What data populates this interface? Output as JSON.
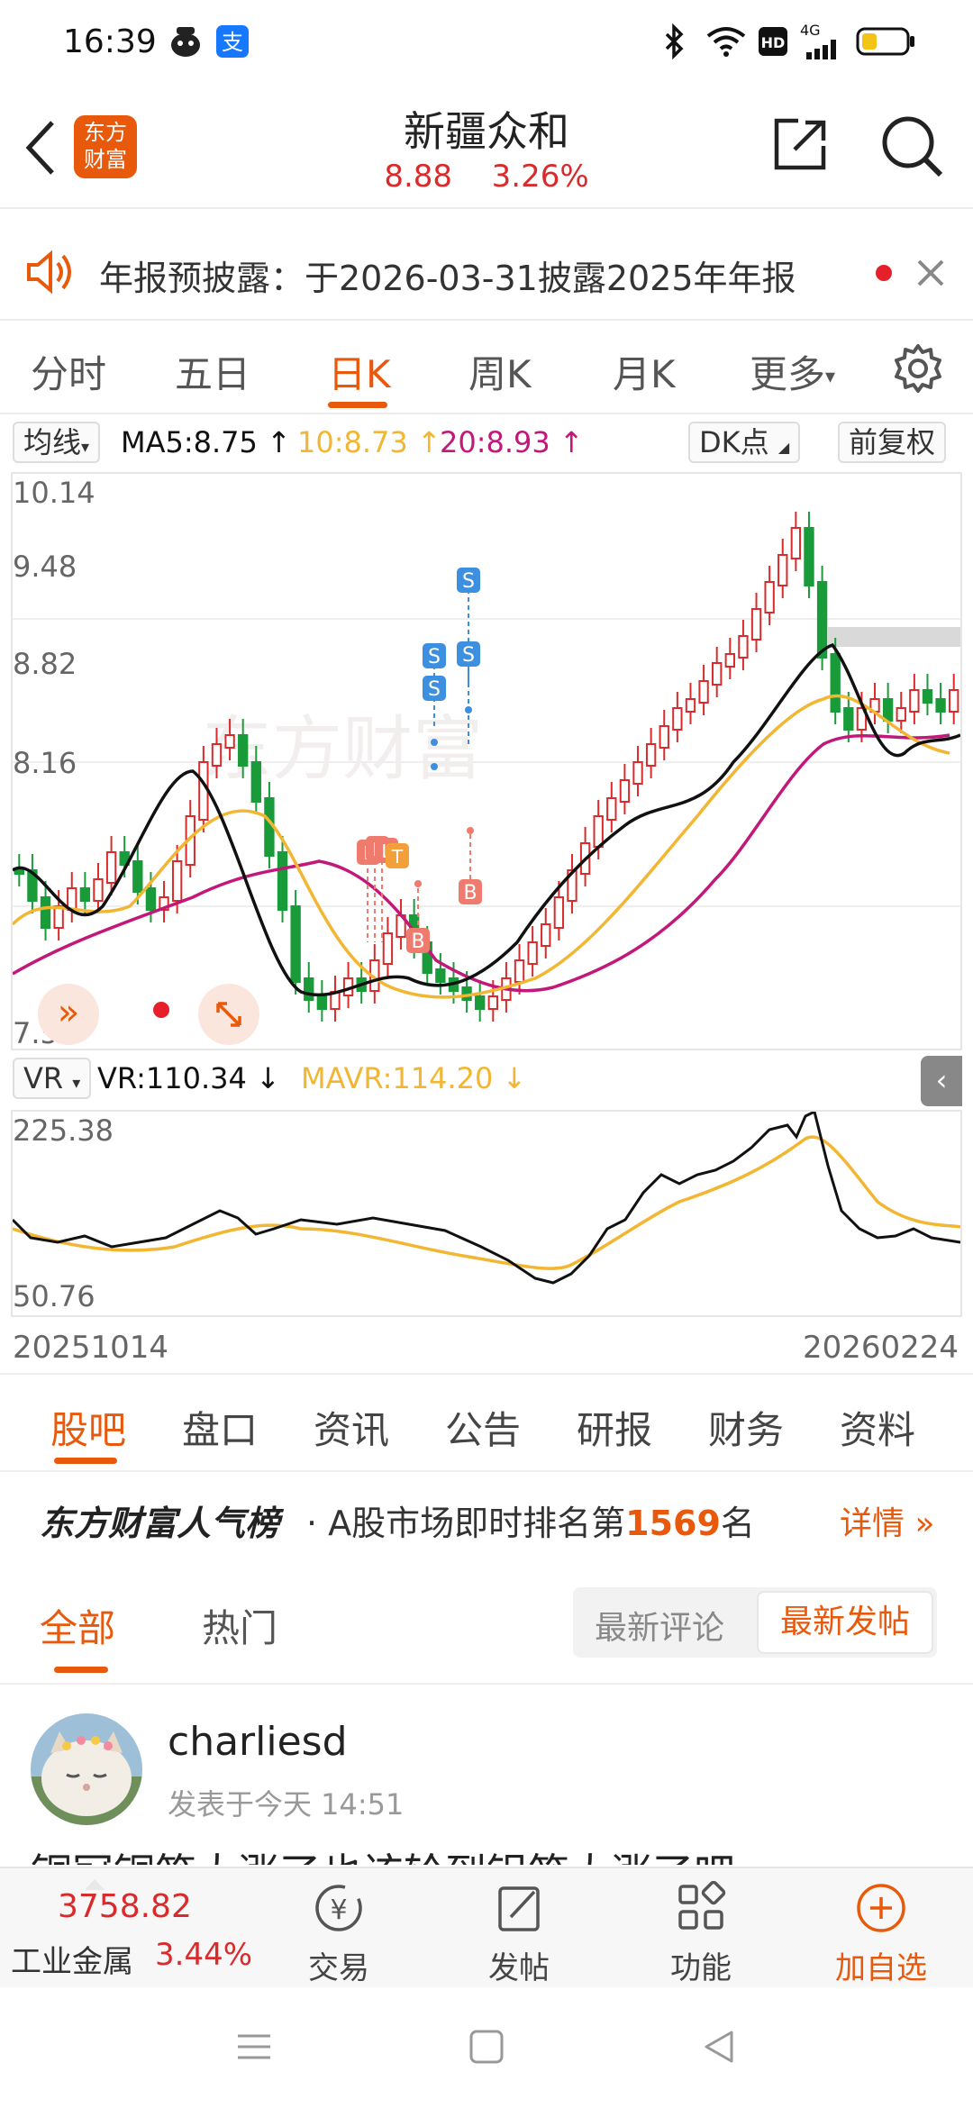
{
  "status_bar": {
    "time": "16:39",
    "network": "4G"
  },
  "header": {
    "stock_name": "新疆众和",
    "price": "8.88",
    "change_pct": "3.26%",
    "logo_text_top": "东方",
    "logo_text_bottom": "财富"
  },
  "notice": {
    "text": "年报预披露：于2026-03-31披露2025年年报"
  },
  "k_tabs": [
    "分时",
    "五日",
    "日K",
    "周K",
    "月K",
    "更多"
  ],
  "k_active_index": 2,
  "indicators": {
    "line_type": "均线",
    "ma5": "MA5:8.75",
    "ma10": "10:8.73",
    "ma20": "20:8.93",
    "dk_label": "DK点",
    "adjust_label": "前复权"
  },
  "main_chart": {
    "y_labels": [
      "10.14",
      "9.48",
      "8.82",
      "8.16",
      "7.50"
    ],
    "watermark": "东方财富"
  },
  "vr": {
    "select_label": "VR",
    "vr_value": "VR:110.34",
    "mavr_value": "MAVR:114.20",
    "y_labels": [
      "225.38",
      "50.76"
    ]
  },
  "dates": {
    "start": "20251014",
    "end": "20260224"
  },
  "sub_tabs": [
    "股吧",
    "盘口",
    "资讯",
    "公告",
    "研报",
    "财务",
    "资料"
  ],
  "sub_active_index": 0,
  "rank": {
    "brand": "东方财富人气榜",
    "text_prefix": "· A股市场即时排名第",
    "rank_number": "1569",
    "text_suffix": "名",
    "details": "详情"
  },
  "filter": {
    "all": "全部",
    "hot": "热门",
    "latest_comment": "最新评论",
    "latest_post": "最新发帖"
  },
  "post": {
    "username": "charliesd",
    "time": "发表于今天 14:51",
    "content": "铜冠铜箔大涨了也该轮到铝箔大涨了吧"
  },
  "bottom_bar": {
    "index_value": "3758.82",
    "index_name": "工业金属",
    "index_change": "3.44%",
    "items": [
      "交易",
      "发帖",
      "功能",
      "加自选"
    ]
  },
  "colors": {
    "accent": "#e8590c",
    "up": "#d92b2b",
    "down": "#1a9b3a",
    "ma5": "#111111",
    "ma10": "#f2b632",
    "ma20": "#c2187a",
    "signal_s": "#3d8fe0",
    "signal_b": "#ef7b6f"
  }
}
